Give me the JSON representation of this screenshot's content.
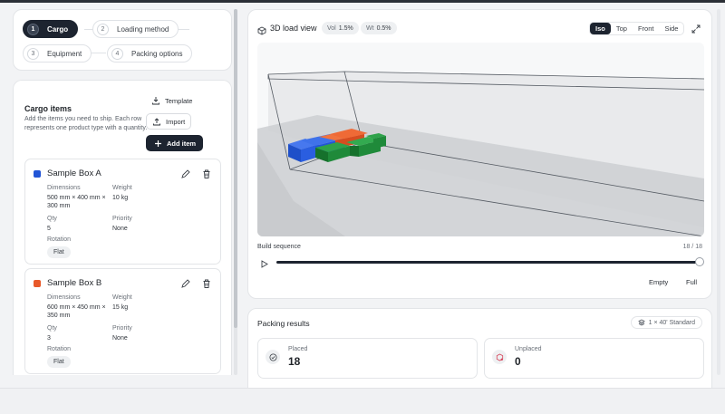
{
  "steps": [
    {
      "num": "1",
      "label": "Cargo",
      "active": true
    },
    {
      "num": "2",
      "label": "Loading method",
      "active": false
    },
    {
      "num": "3",
      "label": "Equipment",
      "active": false
    },
    {
      "num": "4",
      "label": "Packing options",
      "active": false
    }
  ],
  "cargo": {
    "title": "Cargo items",
    "description": "Add the items you need to ship. Each row represents one product type with a quantity.",
    "template_label": "Template",
    "import_label": "Import",
    "add_label": "Add item",
    "labels": {
      "dimensions": "Dimensions",
      "weight": "Weight",
      "qty": "Qty",
      "priority": "Priority",
      "rotation": "Rotation"
    },
    "items": [
      {
        "name": "Sample Box A",
        "color": "#2255d6",
        "dimensions": "500 mm × 400 mm × 300 mm",
        "weight": "10 kg",
        "qty": "5",
        "priority": "None",
        "rotation": "Flat"
      },
      {
        "name": "Sample Box B",
        "color": "#e8592a",
        "dimensions": "600 mm × 450 mm × 350 mm",
        "weight": "15 kg",
        "qty": "3",
        "priority": "None",
        "rotation": "Flat"
      }
    ]
  },
  "viewer": {
    "title": "3D load view",
    "vol_label": "Vol",
    "vol_value": "1.5%",
    "wt_label": "Wt",
    "wt_value": "0.5%",
    "views": [
      "Iso",
      "Top",
      "Front",
      "Side"
    ],
    "active_view": "Iso",
    "sequence_label": "Build sequence",
    "sequence_count": "18 / 18",
    "sequence_progress": 1.0,
    "empty_label": "Empty",
    "full_label": "Full",
    "colors": {
      "blue": "#2255d6",
      "red": "#e8592a",
      "green": "#1f8a3a"
    }
  },
  "results": {
    "title": "Packing results",
    "container": "1 × 40' Standard",
    "placed_label": "Placed",
    "placed_value": "18",
    "unplaced_label": "Unplaced",
    "unplaced_value": "0"
  }
}
